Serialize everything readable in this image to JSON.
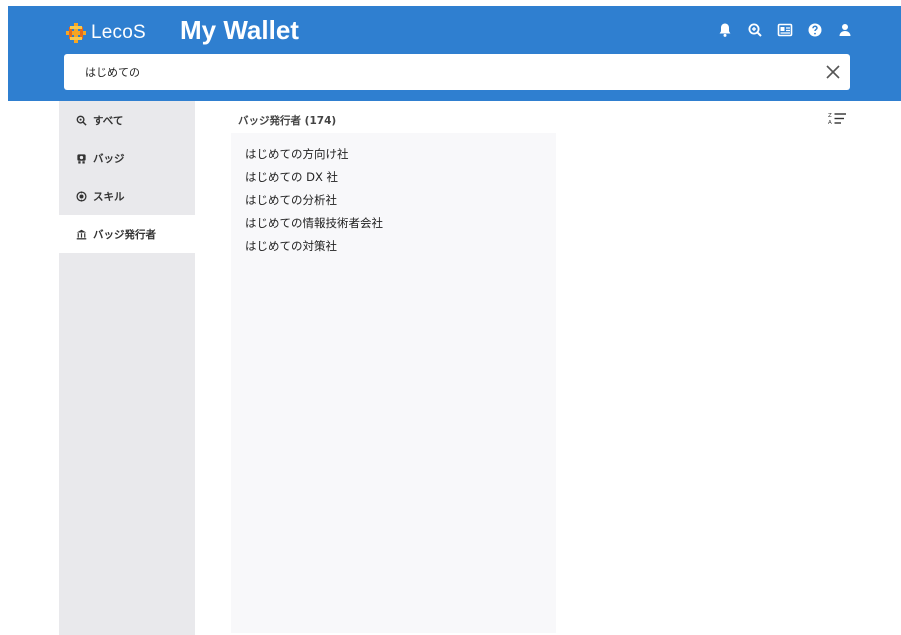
{
  "header": {
    "logo_text": "LecoS",
    "app_title": "My Wallet",
    "icons": [
      "bell-icon",
      "search-zoom-icon",
      "id-card-icon",
      "help-icon",
      "user-icon"
    ]
  },
  "search": {
    "value": "はじめての",
    "placeholder": ""
  },
  "sidebar": {
    "items": [
      {
        "label": "すべて",
        "icon": "search-icon"
      },
      {
        "label": "バッジ",
        "icon": "badge-icon"
      },
      {
        "label": "スキル",
        "icon": "skill-icon"
      },
      {
        "label": "バッジ発行者",
        "icon": "bank-icon",
        "active": true
      }
    ]
  },
  "main": {
    "results_title": "バッジ発行者 (174)",
    "results": [
      "はじめての方向け社",
      "はじめての DX 社",
      "はじめての分析社",
      "はじめての情報技術者会社",
      "はじめての対策社"
    ]
  },
  "colors": {
    "header_bg": "#2f7fd0",
    "sidebar_bg": "#e9e9ec",
    "logo_accent": "#f08a24"
  }
}
